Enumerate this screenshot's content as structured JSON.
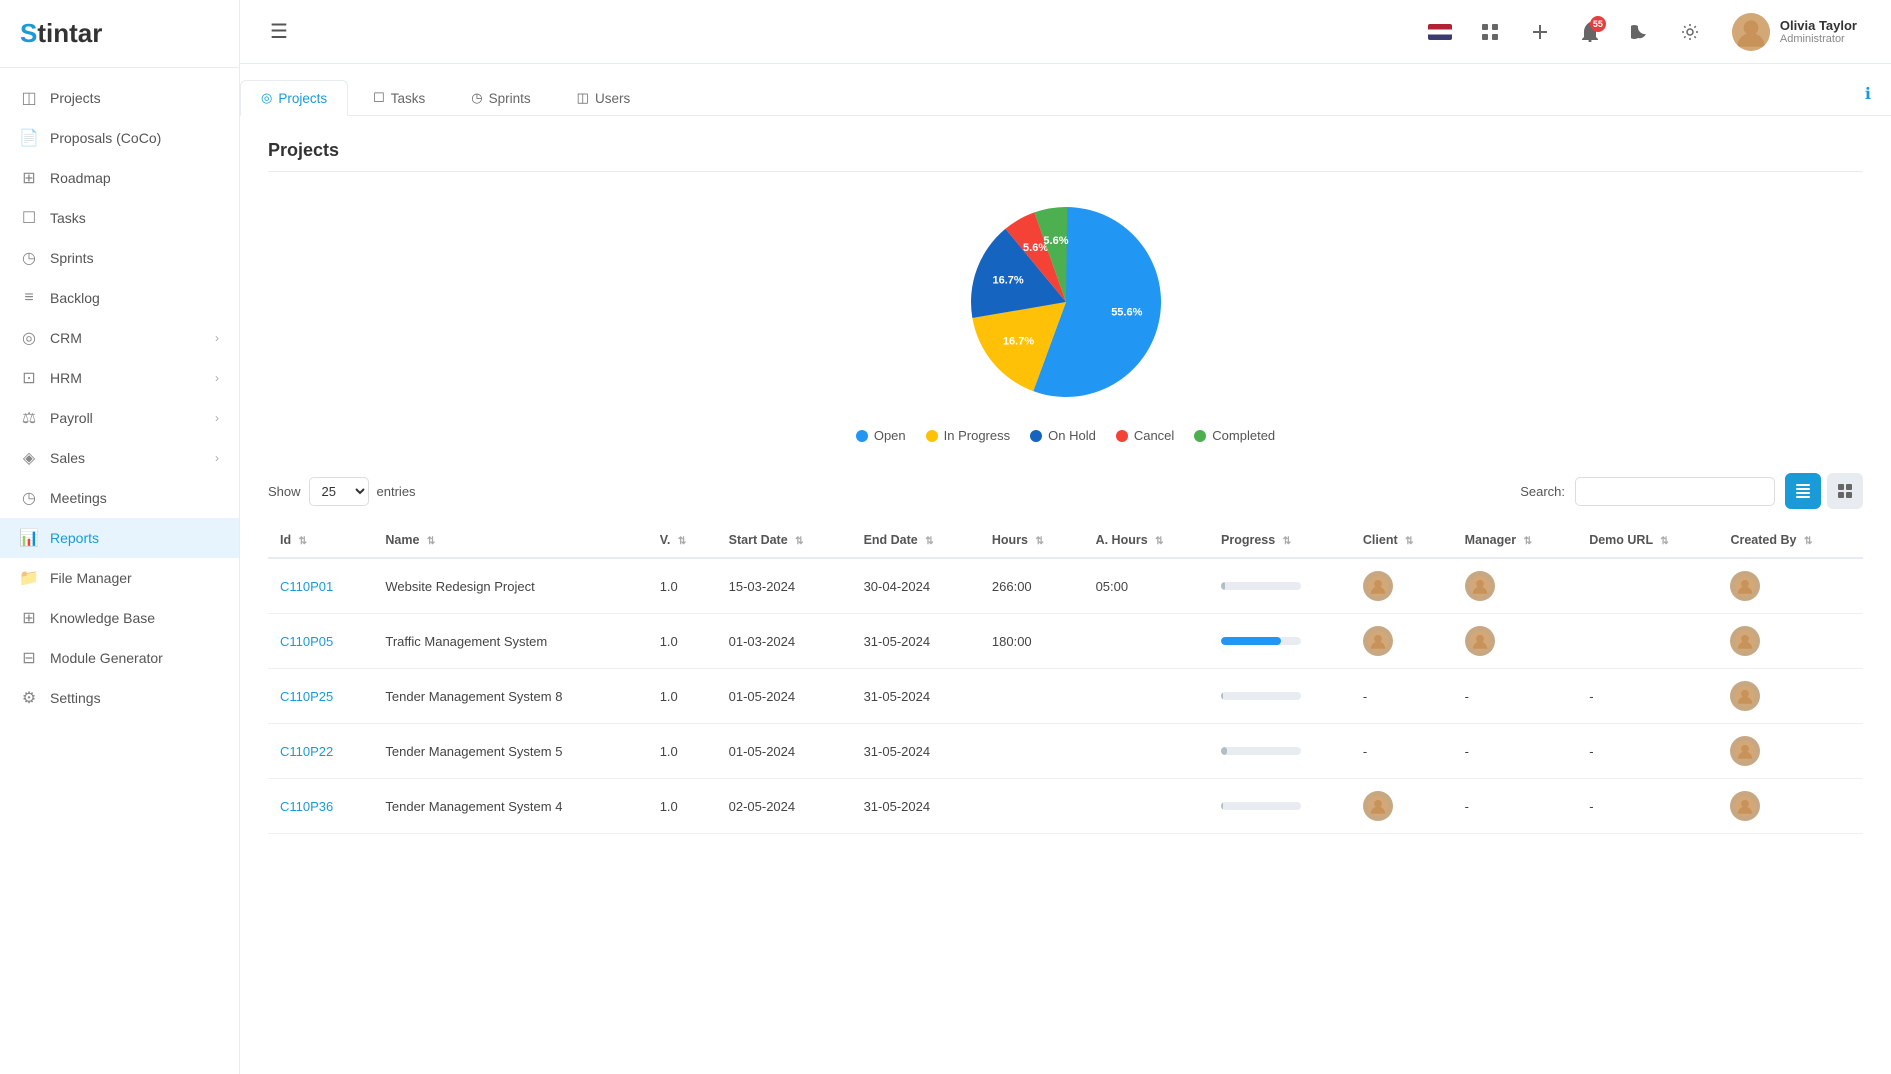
{
  "app": {
    "logo": "Stintar",
    "logo_s": "S",
    "logo_rest": "tintar"
  },
  "sidebar": {
    "items": [
      {
        "id": "projects",
        "label": "Projects",
        "icon": "◫",
        "active": false,
        "hasChevron": false
      },
      {
        "id": "proposals",
        "label": "Proposals (CoCo)",
        "icon": "📄",
        "active": false,
        "hasChevron": false
      },
      {
        "id": "roadmap",
        "label": "Roadmap",
        "icon": "⊞",
        "active": false,
        "hasChevron": false
      },
      {
        "id": "tasks",
        "label": "Tasks",
        "icon": "☐",
        "active": false,
        "hasChevron": false
      },
      {
        "id": "sprints",
        "label": "Sprints",
        "icon": "◷",
        "active": false,
        "hasChevron": false
      },
      {
        "id": "backlog",
        "label": "Backlog",
        "icon": "≡",
        "active": false,
        "hasChevron": false
      },
      {
        "id": "crm",
        "label": "CRM",
        "icon": "◎",
        "active": false,
        "hasChevron": true
      },
      {
        "id": "hrm",
        "label": "HRM",
        "icon": "⊡",
        "active": false,
        "hasChevron": true
      },
      {
        "id": "payroll",
        "label": "Payroll",
        "icon": "⚖",
        "active": false,
        "hasChevron": true
      },
      {
        "id": "sales",
        "label": "Sales",
        "icon": "◈",
        "active": false,
        "hasChevron": true
      },
      {
        "id": "meetings",
        "label": "Meetings",
        "icon": "◷",
        "active": false,
        "hasChevron": false
      },
      {
        "id": "reports",
        "label": "Reports",
        "icon": "📊",
        "active": true,
        "hasChevron": false
      },
      {
        "id": "file-manager",
        "label": "File Manager",
        "icon": "📁",
        "active": false,
        "hasChevron": false
      },
      {
        "id": "knowledge-base",
        "label": "Knowledge Base",
        "icon": "⊞",
        "active": false,
        "hasChevron": false
      },
      {
        "id": "module-generator",
        "label": "Module Generator",
        "icon": "⊟",
        "active": false,
        "hasChevron": false
      },
      {
        "id": "settings",
        "label": "Settings",
        "icon": "⚙",
        "active": false,
        "hasChevron": false
      }
    ]
  },
  "header": {
    "notification_count": "55",
    "user": {
      "name": "Olivia Taylor",
      "role": "Administrator"
    }
  },
  "tabs": [
    {
      "id": "projects",
      "label": "Projects",
      "icon": "◎",
      "active": true
    },
    {
      "id": "tasks",
      "label": "Tasks",
      "icon": "☐",
      "active": false
    },
    {
      "id": "sprints",
      "label": "Sprints",
      "icon": "◷",
      "active": false
    },
    {
      "id": "users",
      "label": "Users",
      "icon": "◫",
      "active": false
    }
  ],
  "page": {
    "title": "Projects"
  },
  "chart": {
    "segments": [
      {
        "label": "Open",
        "value": 55.6,
        "color": "#2196F3",
        "text_color": "#fff"
      },
      {
        "label": "In Progress",
        "value": 16.7,
        "color": "#FFC107",
        "text_color": "#fff"
      },
      {
        "label": "On Hold",
        "value": 16.7,
        "color": "#1565C0",
        "text_color": "#fff"
      },
      {
        "label": "Cancel",
        "value": 5.6,
        "color": "#F44336",
        "text_color": "#fff"
      },
      {
        "label": "Completed",
        "value": 5.6,
        "color": "#4CAF50",
        "text_color": "#fff"
      }
    ]
  },
  "table": {
    "show_label": "Show",
    "entries_label": "entries",
    "show_value": "25",
    "search_label": "Search:",
    "search_placeholder": "",
    "columns": [
      {
        "id": "id",
        "label": "Id"
      },
      {
        "id": "name",
        "label": "Name"
      },
      {
        "id": "v",
        "label": "V."
      },
      {
        "id": "start_date",
        "label": "Start Date"
      },
      {
        "id": "end_date",
        "label": "End Date"
      },
      {
        "id": "hours",
        "label": "Hours"
      },
      {
        "id": "a_hours",
        "label": "A. Hours"
      },
      {
        "id": "progress",
        "label": "Progress"
      },
      {
        "id": "client",
        "label": "Client"
      },
      {
        "id": "manager",
        "label": "Manager"
      },
      {
        "id": "demo_url",
        "label": "Demo URL"
      },
      {
        "id": "created_by",
        "label": "Created By"
      }
    ],
    "rows": [
      {
        "id": "C110P01",
        "name": "Website Redesign Project",
        "v": "1.0",
        "start_date": "15-03-2024",
        "end_date": "30-04-2024",
        "hours": "266:00",
        "a_hours": "05:00",
        "progress": 5,
        "progress_color": "#b0bec5",
        "has_client": true,
        "has_manager": true,
        "demo_url": "",
        "has_created": true
      },
      {
        "id": "C110P05",
        "name": "Traffic Management System",
        "v": "1.0",
        "start_date": "01-03-2024",
        "end_date": "31-05-2024",
        "hours": "180:00",
        "a_hours": "",
        "progress": 75,
        "progress_color": "#2196F3",
        "has_client": true,
        "has_manager": true,
        "demo_url": "",
        "has_created": true
      },
      {
        "id": "C110P25",
        "name": "Tender Management System 8",
        "v": "1.0",
        "start_date": "01-05-2024",
        "end_date": "31-05-2024",
        "hours": "",
        "a_hours": "",
        "progress": 3,
        "progress_color": "#b0bec5",
        "has_client": false,
        "has_manager": false,
        "demo_url": "-",
        "has_created": true
      },
      {
        "id": "C110P22",
        "name": "Tender Management System 5",
        "v": "1.0",
        "start_date": "01-05-2024",
        "end_date": "31-05-2024",
        "hours": "",
        "a_hours": "",
        "progress": 8,
        "progress_color": "#b0bec5",
        "has_client": false,
        "has_manager": false,
        "demo_url": "-",
        "has_created": true
      },
      {
        "id": "C110P36",
        "name": "Tender Management System 4",
        "v": "1.0",
        "start_date": "02-05-2024",
        "end_date": "31-05-2024",
        "hours": "",
        "a_hours": "",
        "progress": 3,
        "progress_color": "#b0bec5",
        "has_client": true,
        "has_manager": false,
        "demo_url": "-",
        "has_created": true
      }
    ]
  }
}
